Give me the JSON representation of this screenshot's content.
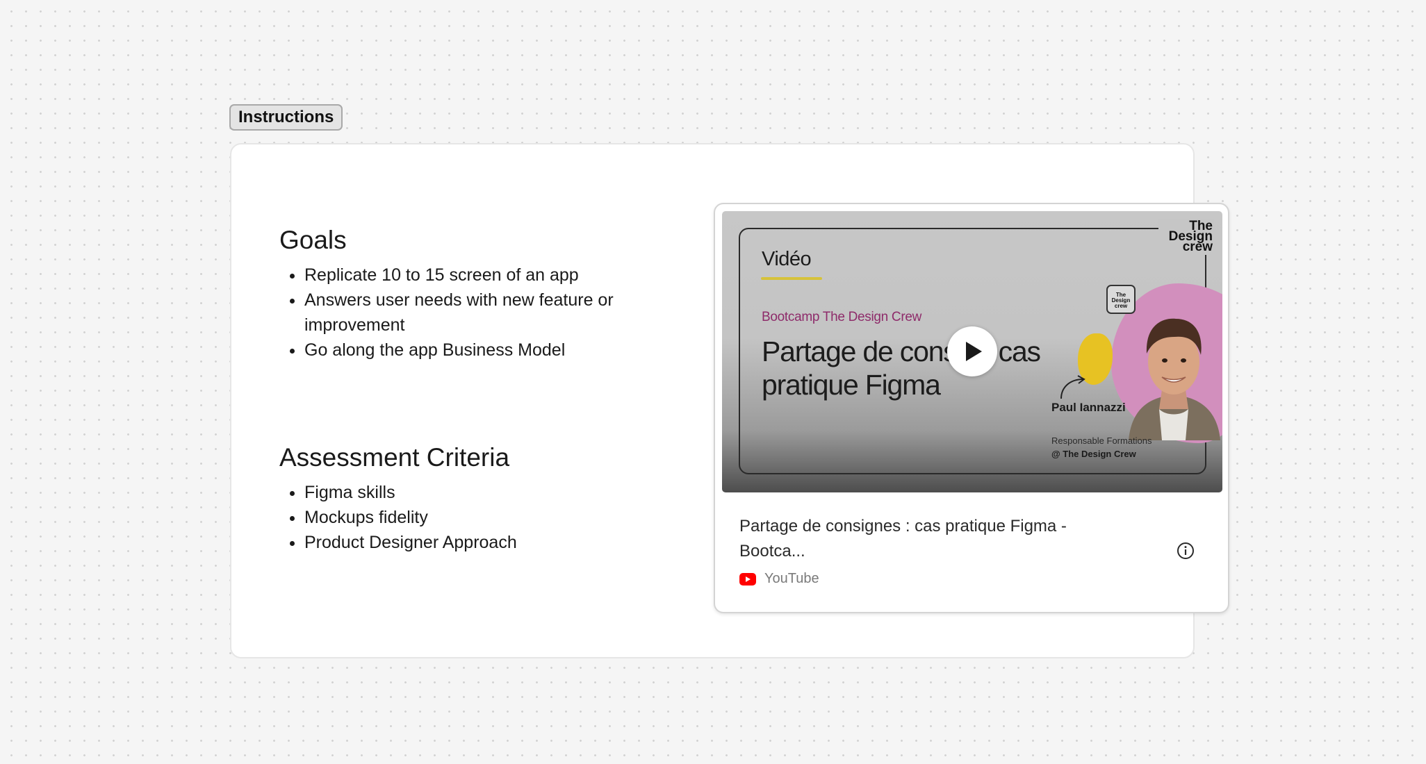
{
  "section": {
    "label": "Instructions"
  },
  "goals": {
    "heading": "Goals",
    "items": [
      "Replicate 10 to 15 screen of an app",
      "Answers user needs with new feature or improvement",
      "Go along the app Business Model"
    ]
  },
  "criteria": {
    "heading": "Assessment Criteria",
    "items": [
      "Figma skills",
      "Mockups fidelity",
      "Product Designer Approach"
    ]
  },
  "embed": {
    "thumbnail": {
      "label": "Vidéo",
      "logo": "The Design crew",
      "badge": "The Design crew",
      "bootcamp": "Bootcamp The Design Crew",
      "title_visible": "Partage de cons s : cas pratique Figma",
      "speaker_name": "Paul Iannazzi",
      "speaker_role": "Responsable Formations",
      "speaker_handle": "@ The Design Crew"
    },
    "title": "Partage de consignes : cas pratique Figma - Bootca...",
    "source": "YouTube",
    "colors": {
      "youtube_red": "#ff0000",
      "bootcamp_magenta": "#8e2b6a",
      "blob_pink": "#d28fbd",
      "blob_yellow": "#e7c223"
    },
    "icons": [
      "play-icon",
      "info-icon",
      "youtube-icon"
    ]
  }
}
